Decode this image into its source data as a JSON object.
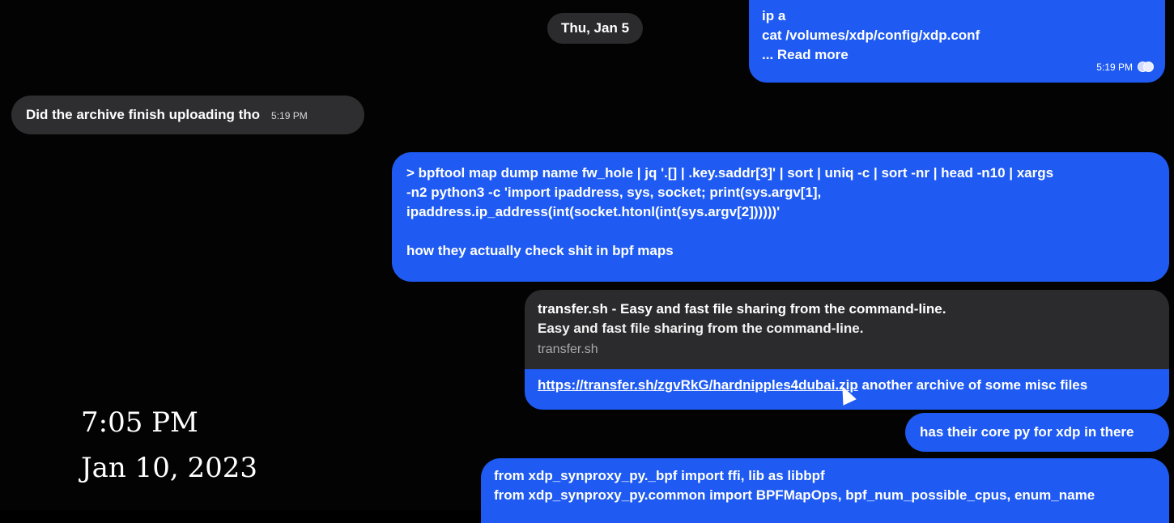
{
  "date_separator": "Thu, Jan 5",
  "messages": {
    "top": {
      "lines": [
        "ip a",
        "cat /volumes/xdp/config/xdp.conf",
        "... Read more"
      ],
      "time": "5:19 PM"
    },
    "incoming": {
      "text": "Did the archive finish uploading tho",
      "time": "5:19 PM"
    },
    "command": {
      "lines": [
        "> bpftool map dump name fw_hole | jq '.[] | .key.saddr[3]' | sort | uniq -c | sort -nr | head -n10 | xargs",
        "-n2 python3 -c 'import ipaddress, sys, socket; print(sys.argv[1],",
        "ipaddress.ip_address(int(socket.htonl(int(sys.argv[2])))))'"
      ],
      "footer": "how they actually check shit in bpf maps"
    },
    "link_preview": {
      "title": "transfer.sh - Easy and fast file sharing from the command-line.",
      "description": "Easy and fast file sharing from the command-line.",
      "domain": "transfer.sh",
      "url": "https://transfer.sh/zgvRkG/hardnipples4dubai.zip",
      "after_text": " another archive of some misc files"
    },
    "core": {
      "text": "has their core py for xdp in there"
    },
    "imports": {
      "lines": [
        "from xdp_synproxy_py._bpf import ffi, lib as libbpf",
        "from xdp_synproxy_py.common import BPFMapOps, bpf_num_possible_cpus, enum_name"
      ]
    }
  },
  "overlay": {
    "time": "7:05 PM",
    "date": "Jan 10, 2023"
  },
  "colors": {
    "outgoing": "#1f5bf2",
    "incoming": "#2e2e31",
    "background": "#030303"
  }
}
